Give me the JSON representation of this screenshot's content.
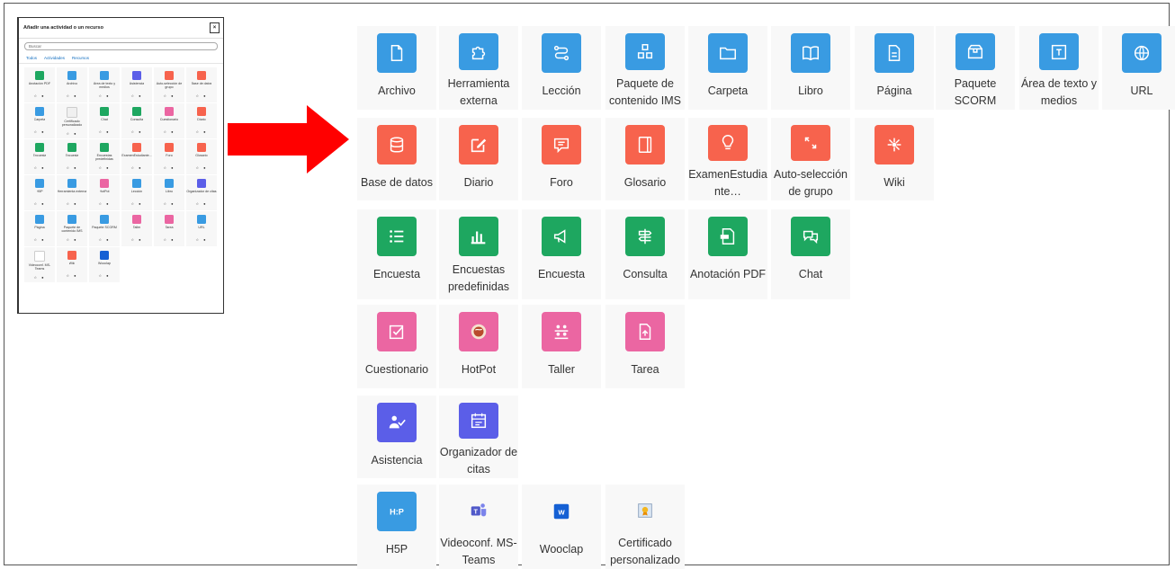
{
  "mini_dialog": {
    "title": "Añadir una actividad o un recurso",
    "search_placeholder": "Buscar",
    "tabs": [
      "Todos",
      "Actividades",
      "Recursos"
    ],
    "items": [
      {
        "label": "Anotación PDF",
        "color": "#1ea760"
      },
      {
        "label": "Archivo",
        "color": "#399be2"
      },
      {
        "label": "Área de texto y medios",
        "color": "#399be2"
      },
      {
        "label": "Asistencia",
        "color": "#5b5ee8"
      },
      {
        "label": "Auto-selección de grupo",
        "color": "#f7634d"
      },
      {
        "label": "Base de datos",
        "color": "#f7634d"
      },
      {
        "label": "Carpeta",
        "color": "#399be2"
      },
      {
        "label": "Certificado personalizado",
        "color": "#f0f0f0"
      },
      {
        "label": "Chat",
        "color": "#1ea760"
      },
      {
        "label": "Consulta",
        "color": "#1ea760"
      },
      {
        "label": "Cuestionario",
        "color": "#eb66a2"
      },
      {
        "label": "Diario",
        "color": "#f7634d"
      },
      {
        "label": "Encuesta",
        "color": "#1ea760"
      },
      {
        "label": "Encuesta",
        "color": "#1ea760"
      },
      {
        "label": "Encuestas predefinidas",
        "color": "#1ea760"
      },
      {
        "label": "ExamenEstudiante...",
        "color": "#f7634d"
      },
      {
        "label": "Foro",
        "color": "#f7634d"
      },
      {
        "label": "Glosario",
        "color": "#f7634d"
      },
      {
        "label": "H5P",
        "color": "#399be2"
      },
      {
        "label": "Herramienta externa",
        "color": "#399be2"
      },
      {
        "label": "HotPot",
        "color": "#eb66a2"
      },
      {
        "label": "Lección",
        "color": "#399be2"
      },
      {
        "label": "Libro",
        "color": "#399be2"
      },
      {
        "label": "Organizador de citas",
        "color": "#5b5ee8"
      },
      {
        "label": "Página",
        "color": "#399be2"
      },
      {
        "label": "Paquete de contenido IMS",
        "color": "#399be2"
      },
      {
        "label": "Paquete SCORM",
        "color": "#399be2"
      },
      {
        "label": "Taller",
        "color": "#eb66a2"
      },
      {
        "label": "Tarea",
        "color": "#eb66a2"
      },
      {
        "label": "URL",
        "color": "#399be2"
      },
      {
        "label": "Videoconf. MS-Teams",
        "color": "#ffffff"
      },
      {
        "label": "Wiki",
        "color": "#f7634d"
      },
      {
        "label": "Wooclap",
        "color": "#1560d4"
      }
    ],
    "dots": "☆ ●"
  },
  "colors": {
    "blue": "#399be2",
    "red": "#f7634d",
    "green": "#1ea760",
    "pink": "#eb66a2",
    "purple": "#5b5ee8",
    "arrow": "#ff0000"
  },
  "rows": [
    [
      {
        "label": "Archivo",
        "icon": "file-icon",
        "color": "#399be2"
      },
      {
        "label": "Herramienta externa",
        "icon": "puzzle-icon",
        "color": "#399be2"
      },
      {
        "label": "Lección",
        "icon": "route-icon",
        "color": "#399be2"
      },
      {
        "label": "Paquete de contenido IMS",
        "icon": "boxes-icon",
        "color": "#399be2"
      },
      {
        "label": "Carpeta",
        "icon": "folder-icon",
        "color": "#399be2"
      },
      {
        "label": "Libro",
        "icon": "book-icon",
        "color": "#399be2"
      },
      {
        "label": "Página",
        "icon": "page-icon",
        "color": "#399be2"
      },
      {
        "label": "Paquete SCORM",
        "icon": "package-icon",
        "color": "#399be2"
      },
      {
        "label": "Área de texto y medios",
        "icon": "textarea-icon",
        "color": "#399be2"
      },
      {
        "label": "URL",
        "icon": "globe-icon",
        "color": "#399be2"
      }
    ],
    [
      {
        "label": "Base de datos",
        "icon": "database-icon",
        "color": "#f7634d"
      },
      {
        "label": "Diario",
        "icon": "edit-icon",
        "color": "#f7634d"
      },
      {
        "label": "Foro",
        "icon": "forum-icon",
        "color": "#f7634d"
      },
      {
        "label": "Glosario",
        "icon": "glossary-icon",
        "color": "#f7634d"
      },
      {
        "label": "ExamenEstudiante...",
        "icon": "exam-icon",
        "color": "#f7634d"
      },
      {
        "label": "Auto-selección de grupo",
        "icon": "group-select-icon",
        "color": "#f7634d"
      },
      {
        "label": "Wiki",
        "icon": "wiki-icon",
        "color": "#f7634d"
      }
    ],
    [
      {
        "label": "Encuesta",
        "icon": "list-icon",
        "color": "#1ea760"
      },
      {
        "label": "Encuestas predefinidas",
        "icon": "bar-chart-icon",
        "color": "#1ea760"
      },
      {
        "label": "Encuesta",
        "icon": "megaphone-icon",
        "color": "#1ea760"
      },
      {
        "label": "Consulta",
        "icon": "signpost-icon",
        "color": "#1ea760"
      },
      {
        "label": "Anotación PDF",
        "icon": "pdf-icon",
        "color": "#1ea760"
      },
      {
        "label": "Chat",
        "icon": "chat-icon",
        "color": "#1ea760"
      }
    ],
    [
      {
        "label": "Cuestionario",
        "icon": "checkbox-icon",
        "color": "#eb66a2"
      },
      {
        "label": "HotPot",
        "icon": "hotpot-icon",
        "color": "#eb66a2"
      },
      {
        "label": "Taller",
        "icon": "workshop-icon",
        "color": "#eb66a2"
      },
      {
        "label": "Tarea",
        "icon": "assignment-icon",
        "color": "#eb66a2"
      }
    ],
    [
      {
        "label": "Asistencia",
        "icon": "attendance-icon",
        "color": "#5b5ee8"
      },
      {
        "label": "Organizador de citas",
        "icon": "scheduler-icon",
        "color": "#5b5ee8"
      }
    ],
    [
      {
        "label": "H5P",
        "icon": "h5p-icon",
        "color": "#399be2"
      },
      {
        "label": "Videoconf. MS-Teams",
        "icon": "teams-icon",
        "color": "#f8f8f8"
      },
      {
        "label": "Wooclap",
        "icon": "wooclap-icon",
        "color": "#f8f8f8"
      },
      {
        "label": "Certificado personalizado",
        "icon": "certificate-icon",
        "color": "#f8f8f8"
      }
    ]
  ]
}
